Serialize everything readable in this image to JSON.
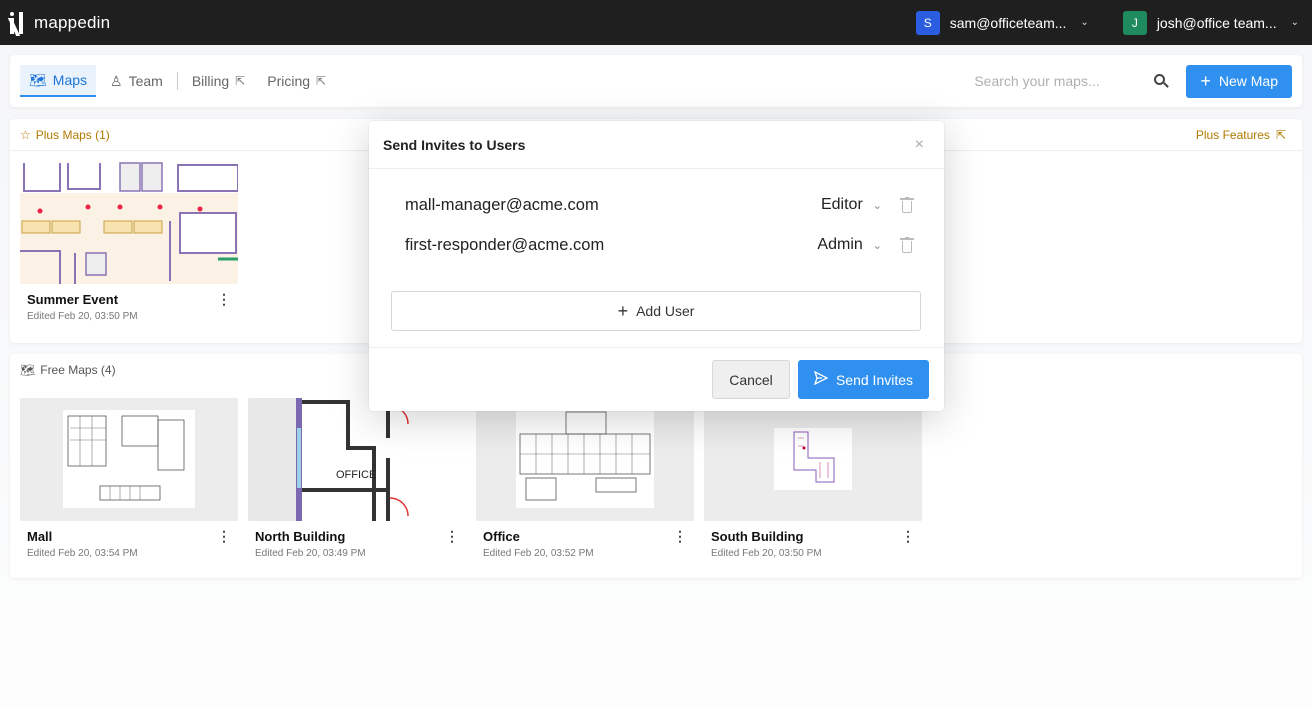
{
  "app": {
    "logo_text": "mappedin",
    "accounts": [
      {
        "initial": "S",
        "name": "sam@officeteam...",
        "color": "#2b5de0"
      },
      {
        "initial": "J",
        "name": "josh@office team...",
        "color": "#1e8a5e"
      }
    ]
  },
  "nav": {
    "tabs": [
      {
        "label": "Maps",
        "icon": "map-icon",
        "active": true
      },
      {
        "label": "Team",
        "icon": "user-icon",
        "active": false
      },
      {
        "label": "Billing",
        "icon": "external-link-icon",
        "active": false
      },
      {
        "label": "Pricing",
        "icon": "external-link-icon",
        "active": false
      }
    ],
    "search_placeholder": "Search your maps...",
    "new_map_label": "New Map"
  },
  "plus_section": {
    "title": "Plus Maps (1)",
    "features_link": "Plus Features",
    "maps": [
      {
        "name": "Summer Event",
        "edited": "Edited Feb 20, 03:50 PM"
      }
    ]
  },
  "free_section": {
    "title": "Free Maps (4)",
    "maps": [
      {
        "name": "Mall",
        "edited": "Edited Feb 20, 03:54 PM"
      },
      {
        "name": "North Building",
        "edited": "Edited Feb 20, 03:49 PM"
      },
      {
        "name": "Office",
        "edited": "Edited Feb 20, 03:52 PM"
      },
      {
        "name": "South Building",
        "edited": "Edited Feb 20, 03:50 PM"
      }
    ]
  },
  "modal": {
    "title": "Send Invites to Users",
    "invites": [
      {
        "email": "mall-manager@acme.com",
        "role": "Editor"
      },
      {
        "email": "first-responder@acme.com",
        "role": "Admin"
      }
    ],
    "add_user_label": "Add User",
    "cancel_label": "Cancel",
    "send_label": "Send Invites"
  },
  "thumb_labels": {
    "north_office": "OFFICE"
  },
  "colors": {
    "accent": "#2f90f0",
    "plus_gold": "#b07a00",
    "topbar": "#1f1f1f"
  }
}
